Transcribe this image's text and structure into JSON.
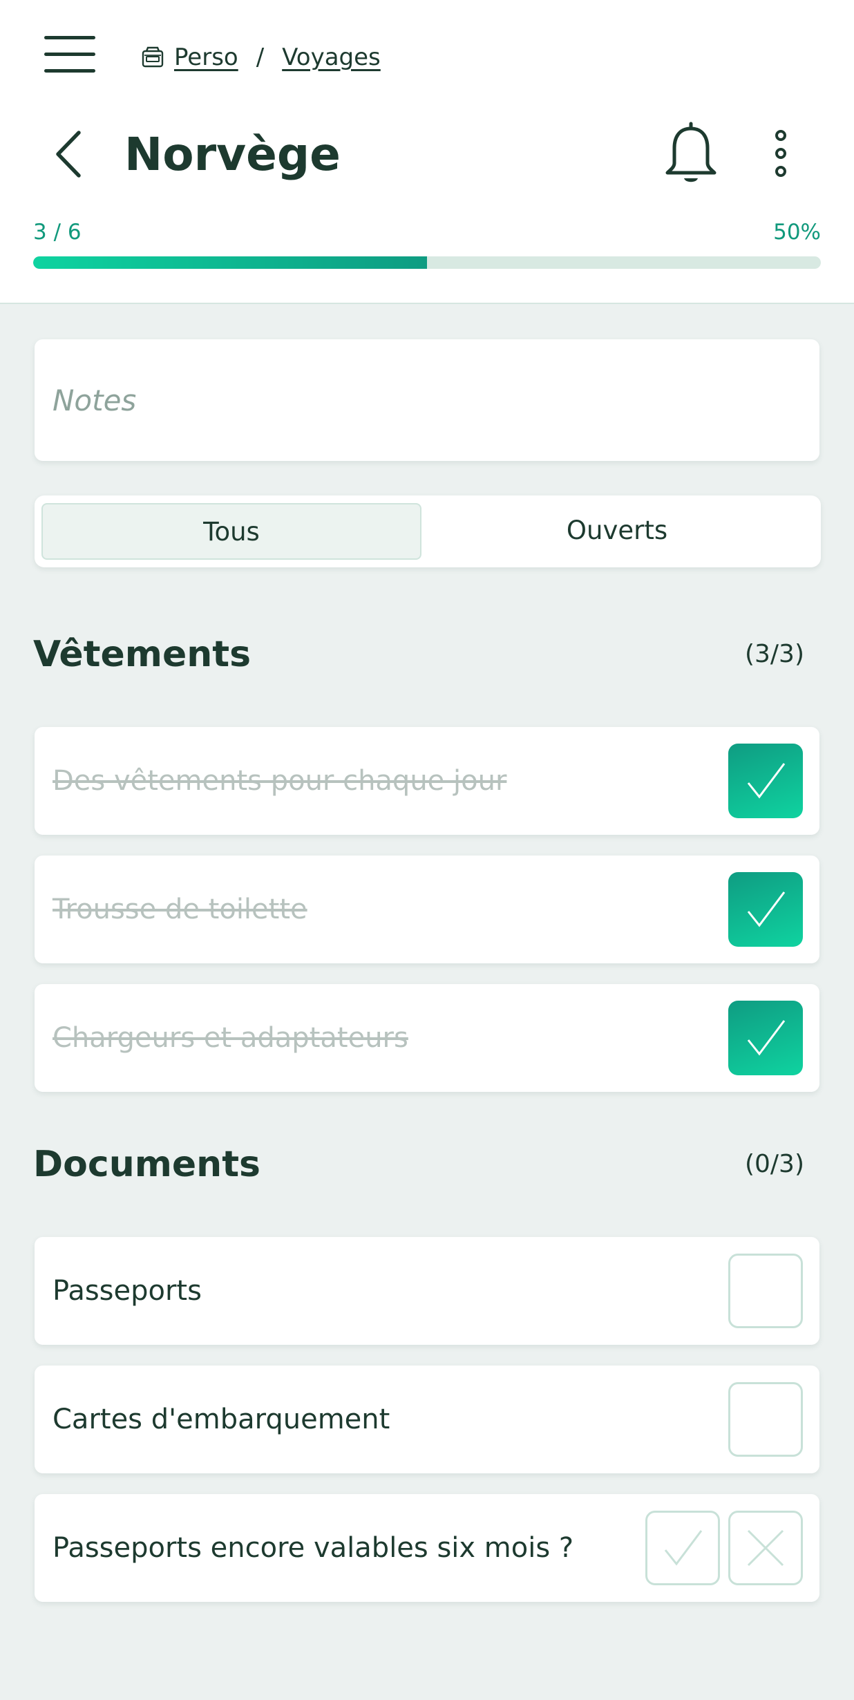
{
  "breadcrumb": {
    "items": [
      "Perso",
      "Voyages"
    ],
    "separator": "/"
  },
  "header": {
    "title": "Norvège",
    "progress_count": "3 / 6",
    "progress_percent": "50%",
    "progress_fraction": 0.5
  },
  "notes": {
    "placeholder": "Notes"
  },
  "filter": {
    "tabs": [
      "Tous",
      "Ouverts"
    ],
    "active": "Tous"
  },
  "sections": [
    {
      "title": "Vêtements",
      "count": "(3/3)",
      "items": [
        {
          "label": "Des vêtements pour chaque jour",
          "checked": true
        },
        {
          "label": "Trousse de toilette",
          "checked": true
        },
        {
          "label": "Chargeurs et adaptateurs",
          "checked": true
        }
      ]
    },
    {
      "title": "Documents",
      "count": "(0/3)",
      "items": [
        {
          "label": "Passeports",
          "checked": false
        },
        {
          "label": "Cartes d'embarquement",
          "checked": false
        },
        {
          "label": "Passeports encore valables six mois ?",
          "checked": false,
          "type": "yes-no"
        }
      ]
    }
  ],
  "colors": {
    "accent": "#0fd3a0",
    "accent_dark": "#0f9c82",
    "text": "#1d3a2f",
    "background": "#ecf1f0",
    "done_text": "#b7c2be"
  },
  "icons": [
    "menu-icon",
    "folder-icon",
    "back-arrow-icon",
    "bell-icon",
    "more-vertical-icon",
    "checkmark-icon",
    "close-icon"
  ]
}
